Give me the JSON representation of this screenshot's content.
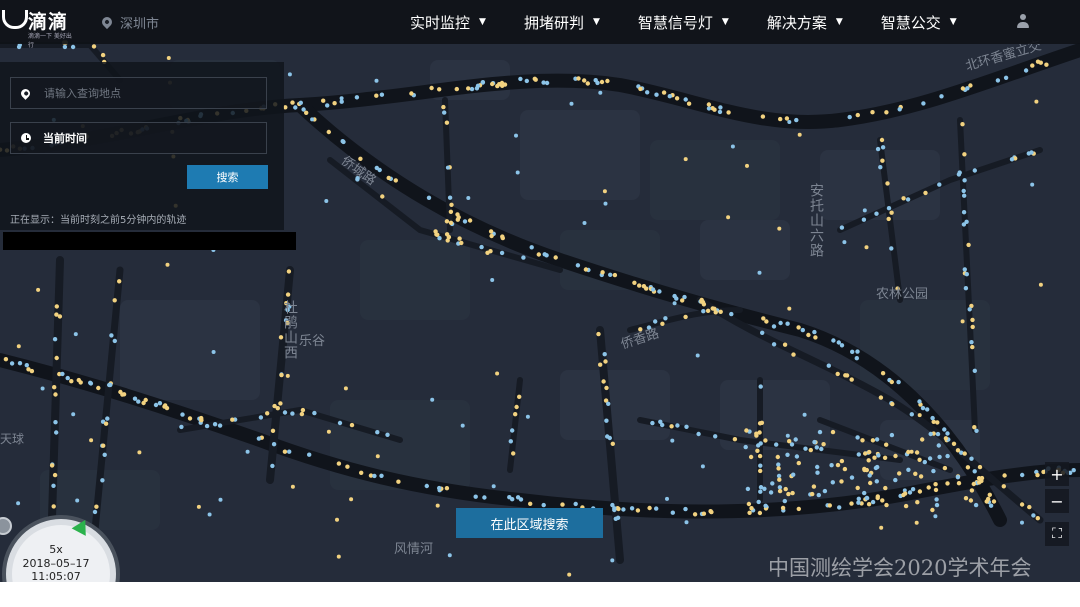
{
  "app": {
    "logo_text": "滴滴",
    "logo_slogan": "滴滴一下 美好出行",
    "city": "深圳市"
  },
  "nav": {
    "items": [
      {
        "label": "实时监控",
        "caret": "▼"
      },
      {
        "label": "拥堵研判",
        "caret": "▼"
      },
      {
        "label": "智慧信号灯",
        "caret": "▼"
      },
      {
        "label": "解决方案",
        "caret": "▼"
      },
      {
        "label": "智慧公交",
        "caret": "▼"
      }
    ]
  },
  "search": {
    "placeholder": "请输入查询地点",
    "time_label": "当前时间",
    "button": "搜索",
    "showing": "正在显示：当前时刻之前5分钟内的轨迹"
  },
  "map": {
    "area_search_button": "在此区域搜索",
    "zoom_in": "+",
    "zoom_out": "−",
    "fullscreen": "⛶",
    "labels": {
      "nonglin": "农林公园",
      "anhe": "安托山六路",
      "shanglegu": "乐谷",
      "duchuang": "杜鹃山西",
      "fengqinghe": "风情河",
      "qiaoxiang": "侨香路",
      "jiqiao": "侨城路",
      "tianqiu": "天球",
      "beihuan": "北环香蜜立交"
    },
    "colors": {
      "background": "#252c3a",
      "road": "#161b24",
      "major_road": "#10141b",
      "block": "#2e3646",
      "green": "#2a3340",
      "dot_blue": "#8cc4e8",
      "dot_yellow": "#f2d280"
    }
  },
  "playback": {
    "speed": "5x",
    "date": "2018–05–17",
    "time": "11:05:07"
  },
  "watermark": "中国测绘学会2020学术年会"
}
